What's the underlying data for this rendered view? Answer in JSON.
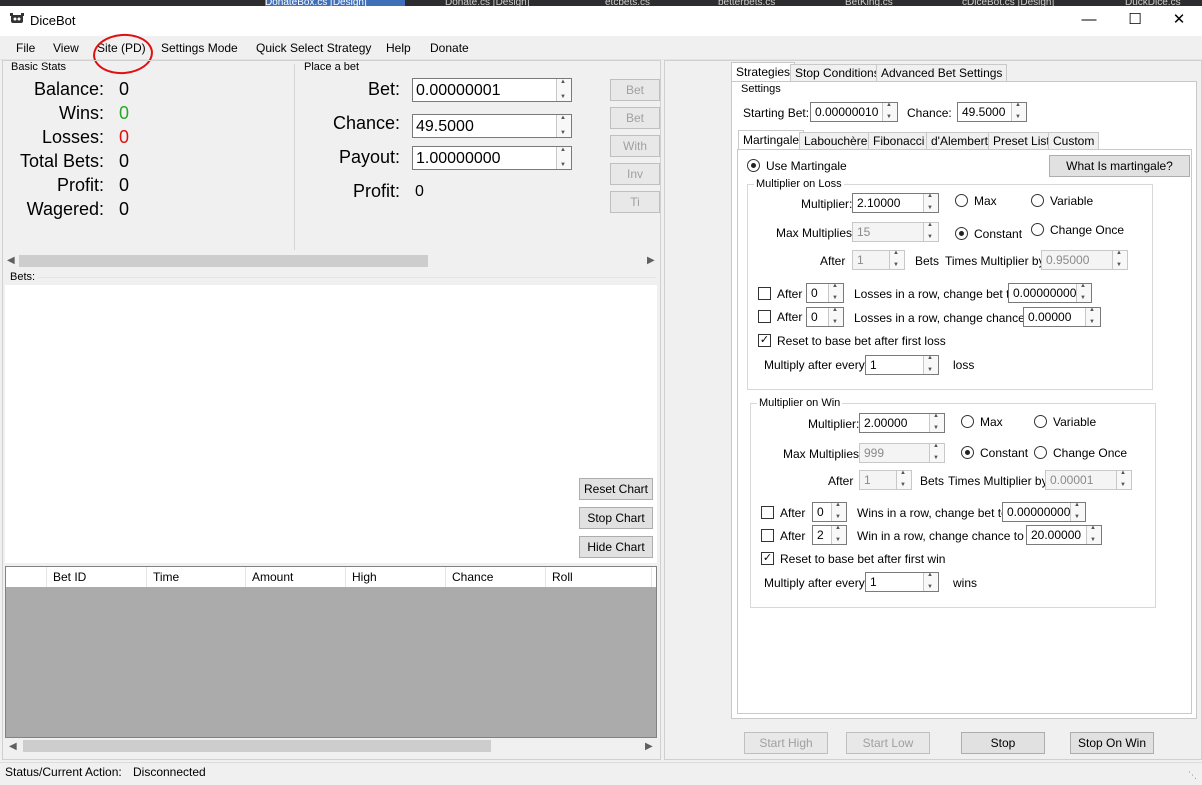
{
  "bg_tabs": [
    "DonateBox.cs [Design]",
    "Donate.cs [Design]",
    "etcbets.cs",
    "betterbets.cs",
    "BetKing.cs",
    "cDiceBot.cs [Design]",
    "DuckDice.cs"
  ],
  "window": {
    "title": "DiceBot",
    "min": "—",
    "max": "☐",
    "close": "✕"
  },
  "menu": [
    "File",
    "View",
    "Site (PD)",
    "Settings Mode",
    "Quick Select Strategy",
    "Help",
    "Donate"
  ],
  "basic_stats": {
    "title": "Basic Stats",
    "balance_label": "Balance:",
    "balance": "0",
    "wins_label": "Wins:",
    "wins": "0",
    "losses_label": "Losses:",
    "losses": "0",
    "total_bets_label": "Total Bets:",
    "total_bets": "0",
    "profit_label": "Profit:",
    "profit": "0",
    "wagered_label": "Wagered:",
    "wagered": "0"
  },
  "place_bet": {
    "title": "Place a bet",
    "bet_label": "Bet:",
    "bet": "0.00000001",
    "chance_label": "Chance:",
    "chance": "49.5000",
    "payout_label": "Payout:",
    "payout": "1.00000000",
    "profit_label": "Profit:",
    "profit": "0",
    "side_buttons": [
      "Bet",
      "Bet",
      "With",
      "Inv",
      "Ti"
    ]
  },
  "bets_label": "Bets:",
  "chart_buttons": {
    "reset": "Reset Chart",
    "stop": "Stop Chart",
    "hide": "Hide Chart"
  },
  "table": {
    "columns": [
      "Bet ID",
      "Time",
      "Amount",
      "High",
      "Chance",
      "Roll"
    ]
  },
  "status": {
    "label": "Status/Current Action:",
    "value": "Disconnected"
  },
  "right": {
    "tabs": [
      "Strategies",
      "Stop Conditions",
      "Advanced Bet Settings"
    ],
    "settings_title": "Settings",
    "starting_bet_label": "Starting Bet:",
    "starting_bet": "0.00000010",
    "chance_label": "Chance:",
    "chance": "49.5000",
    "strategy_tabs": [
      "Martingale",
      "Labouchère",
      "Fibonacci",
      "d'Alembert",
      "Preset List",
      "Custom"
    ],
    "use_martingale": "Use Martingale",
    "what_is": "What Is martingale?",
    "loss": {
      "title": "Multiplier on Loss",
      "multiplier_label": "Multiplier:",
      "multiplier": "2.10000",
      "max_label": "Max",
      "variable_label": "Variable",
      "max_mult_label": "Max Multiplies:",
      "max_mult": "15",
      "constant_label": "Constant",
      "change_once_label": "Change Once",
      "after_label": "After",
      "after": "1",
      "bets_label": "Bets",
      "times_label": "Times Multiplier by:",
      "times": "0.95000",
      "row1_after": "After",
      "row1_val": "0",
      "row1_text": "Losses in a row, change bet to",
      "row1_target": "0.00000000",
      "row2_after": "After",
      "row2_val": "0",
      "row2_text": "Losses in a row, change chance to",
      "row2_target": "0.00000",
      "reset_label": "Reset to base bet after first loss",
      "every_label": "Multiply after every",
      "every": "1",
      "every_unit": "loss"
    },
    "win": {
      "title": "Multiplier on Win",
      "multiplier_label": "Multiplier:",
      "multiplier": "2.00000",
      "max_label": "Max",
      "variable_label": "Variable",
      "max_mult_label": "Max Multiplies:",
      "max_mult": "999",
      "constant_label": "Constant",
      "change_once_label": "Change Once",
      "after_label": "After",
      "after": "1",
      "bets_label": "Bets",
      "times_label": "Times Multiplier by:",
      "times": "0.00001",
      "row1_after": "After",
      "row1_val": "0",
      "row1_text": "Wins in a row, change bet to",
      "row1_target": "0.00000000",
      "row2_after": "After",
      "row2_val": "2",
      "row2_text": "Win in a row, change chance to",
      "row2_target": "20.00000",
      "reset_label": "Reset to base bet after first win",
      "every_label": "Multiply after every",
      "every": "1",
      "every_unit": "wins"
    },
    "bottom_buttons": {
      "start_high": "Start High",
      "start_low": "Start Low",
      "stop": "Stop",
      "stop_on_win": "Stop On Win"
    }
  },
  "colors": {
    "wins": "#2aa52a",
    "losses": "#e01010",
    "annotation": "#e01010"
  }
}
